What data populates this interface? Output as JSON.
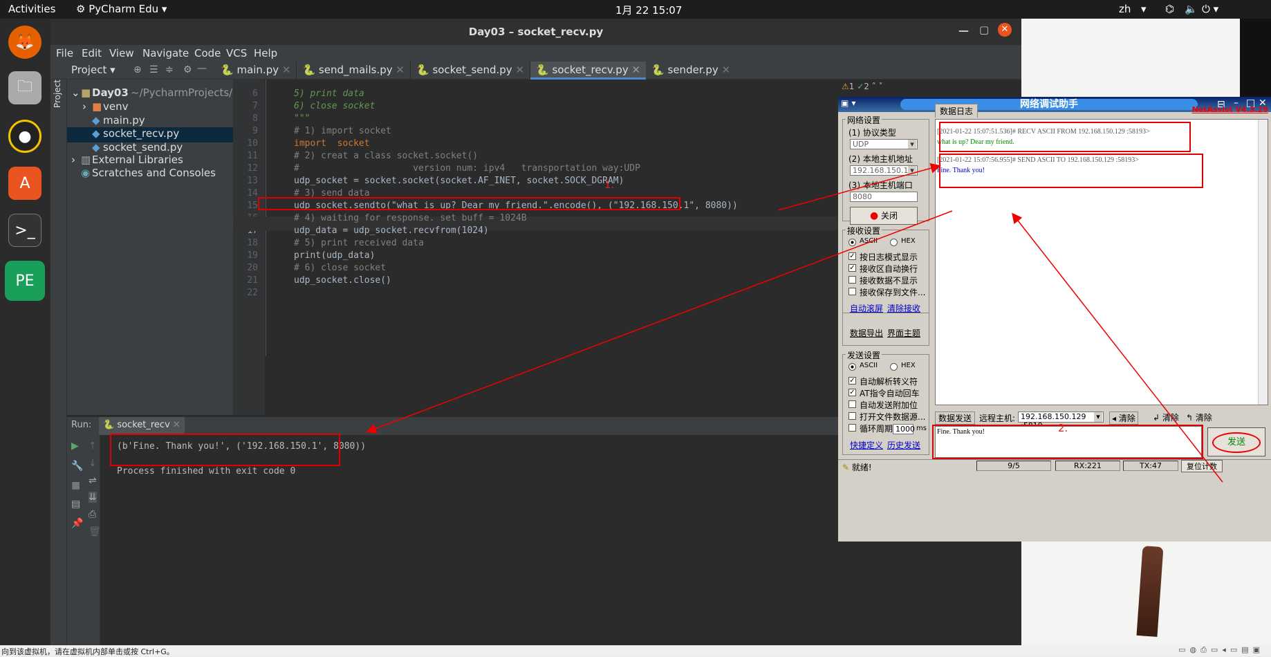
{
  "topbar": {
    "activities": "Activities",
    "app": "PyCharm Edu",
    "clock": "1月 22  15:07",
    "lang": "zh"
  },
  "window": {
    "title": "Day03 – socket_recv.py"
  },
  "menu": [
    "File",
    "Edit",
    "View",
    "Navigate",
    "Code",
    "VCS",
    "Help"
  ],
  "project": {
    "header": "Project",
    "side_label": "Project",
    "root": "Day03",
    "root_path": "~/PycharmProjects/Day",
    "items": [
      "venv",
      "main.py",
      "socket_recv.py",
      "socket_send.py",
      "External Libraries",
      "Scratches and Consoles"
    ]
  },
  "tabs": [
    "main.py",
    "send_mails.py",
    "socket_send.py",
    "socket_recv.py",
    "sender.py"
  ],
  "inspection": {
    "warn": "1",
    "ok": "2"
  },
  "code": {
    "line_numbers": [
      "6",
      "7",
      "8",
      "9",
      "10",
      "11",
      "12",
      "13",
      "14",
      "15",
      "16",
      "17",
      "18",
      "19",
      "20",
      "21",
      "22"
    ],
    "lines": [
      "5) print data",
      "6) close socket",
      "\"\"\"",
      "# 1) import socket",
      "import  socket",
      "# 2) creat a class socket.socket()",
      "#                     version num: ipv4   transportation way:UDP",
      "udp_socket = socket.socket(socket.AF_INET, socket.SOCK_DGRAM)",
      "# 3) send data",
      "udp_socket.sendto(\"what is up? Dear my friend.\".encode(), (\"192.168.150.1\", 8080))",
      "# 4) waiting for response. set buff = 1024B",
      "udp_data = udp_socket.recvfrom(1024)",
      "# 5) print received data",
      "print(udp_data)",
      "# 6) close socket",
      "udp_socket.close()",
      ""
    ]
  },
  "annotations": {
    "one": "1.",
    "two": "2."
  },
  "run": {
    "label": "Run:",
    "tab": "socket_recv",
    "output1": "(b'Fine. Thank you!', ('192.168.150.1', 8080))",
    "output2": "Process finished with exit code 0"
  },
  "netassist": {
    "title": "网络调试助手",
    "brand": "NetAssist V4.3.29",
    "net_settings": "网络设置",
    "protocol_label": "(1) 协议类型",
    "protocol": "UDP",
    "host_label": "(2) 本地主机地址",
    "host": "192.168.150.1",
    "port_label": "(3) 本地主机端口",
    "port": "8080",
    "close_btn": "关闭",
    "recv_settings": "接收设置",
    "ascii": "ASCII",
    "hex": "HEX",
    "recv_opts": [
      "按日志模式显示",
      "接收区自动换行",
      "接收数据不显示",
      "接收保存到文件..."
    ],
    "recv_checked": [
      true,
      true,
      false,
      false
    ],
    "auto_scroll": "自动滚屏",
    "clear_recv": "清除接收",
    "export": "数据导出",
    "theme": "界面主题",
    "send_settings": "发送设置",
    "send_opts": [
      "自动解析转义符",
      "AT指令自动回车",
      "自动发送附加位",
      "打开文件数据源...",
      "循环周期"
    ],
    "send_checked": [
      true,
      true,
      false,
      false,
      false
    ],
    "period": "1000",
    "ms": "ms",
    "shortcut": "快捷定义",
    "history": "历史发送",
    "log_tab": "数据日志",
    "log1_head": "[2021-01-22 15:07:51.536]# RECV ASCII FROM 192.168.150.129 :58193>",
    "log1_body": "what is up? Dear my friend.",
    "log2_head": "[2021-01-22 15:07:56.955]# SEND ASCII TO 192.168.150.129 :58193>",
    "log2_body": "Fine. Thank you!",
    "send_tab": "数据发送",
    "remote_label": "远程主机:",
    "remote": "192.168.150.129 :5819",
    "clear1": "清除",
    "clear2": "清除",
    "clear3": "清除",
    "send_text": "Fine. Thank you!",
    "send_btn": "发送",
    "status": "就绪!",
    "count": "9/5",
    "rx": "RX:221",
    "tx": "TX:47",
    "reset": "复位计数"
  },
  "bottom_hint": "向到该虚拟机，请在虚拟机内部单击或按 Ctrl+G。"
}
